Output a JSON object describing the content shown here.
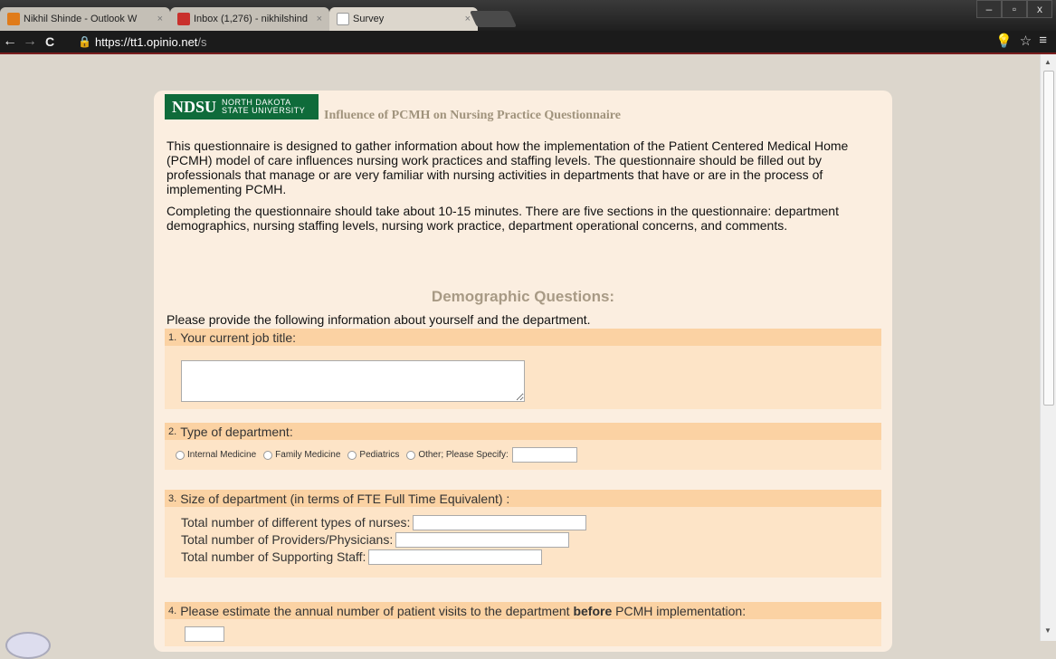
{
  "tabs": [
    {
      "title": "Nikhil Shinde - Outlook W",
      "favicon_color": "#e07b1a"
    },
    {
      "title": "Inbox (1,276) - nikhilshind",
      "favicon_color": "#c9302c"
    },
    {
      "title": "Survey",
      "favicon_color": "#ffffff",
      "active": true
    }
  ],
  "window_controls": {
    "minimize": "–",
    "maximize": "▫",
    "close": "x"
  },
  "toolbar": {
    "back": "←",
    "forward": "→",
    "reload": "C",
    "url_host": "https://tt1.opinio.net",
    "url_path": "/s"
  },
  "header": {
    "logo_main": "NDSU",
    "logo_line1": "NORTH DAKOTA",
    "logo_line2": "STATE UNIVERSITY",
    "title": "Influence of PCMH on Nursing Practice Questionnaire"
  },
  "intro": {
    "para1": "This questionnaire is designed to gather information about how the implementation of the Patient Centered Medical Home (PCMH) model of care influences nursing work practices and staffing levels. The questionnaire should be filled out by professionals that manage or are very familiar with nursing activities in departments that have or are in the process of implementing PCMH.",
    "para2": "Completing the questionnaire should take about 10-15 minutes. There are five sections in the questionnaire: department demographics, nursing staffing levels, nursing work practice, department operational concerns, and comments."
  },
  "section": {
    "title": "Demographic Questions:",
    "subtitle": "Please provide the following information about yourself and the department."
  },
  "questions": [
    {
      "num": "1.",
      "text": "Your current job title:"
    },
    {
      "num": "2.",
      "text": "Type of department:",
      "options": [
        "Internal Medicine",
        "Family Medicine",
        "Pediatrics",
        "Other; Please Specify:"
      ]
    },
    {
      "num": "3.",
      "text": "Size of department (in terms of FTE Full Time Equivalent) :",
      "fields": [
        "Total number of different types of nurses:",
        "Total number of Providers/Physicians:",
        "Total number of Supporting Staff:"
      ]
    },
    {
      "num": "4.",
      "text_pre": "Please estimate the annual number of patient visits to the department ",
      "text_bold": "before",
      "text_post": " PCMH implementation:"
    }
  ]
}
